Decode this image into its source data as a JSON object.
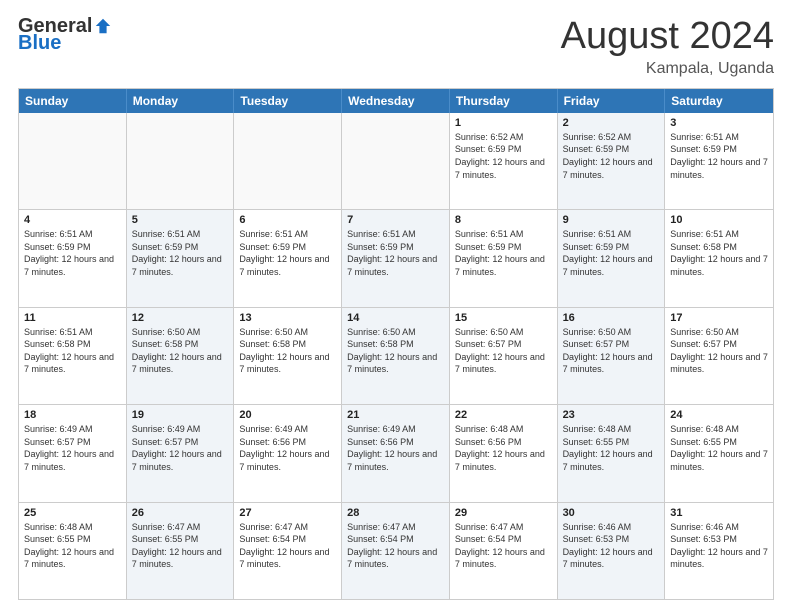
{
  "logo": {
    "general": "General",
    "blue": "Blue"
  },
  "title": "August 2024",
  "location": "Kampala, Uganda",
  "header_days": [
    "Sunday",
    "Monday",
    "Tuesday",
    "Wednesday",
    "Thursday",
    "Friday",
    "Saturday"
  ],
  "rows": [
    [
      {
        "day": "",
        "info": "",
        "empty": true
      },
      {
        "day": "",
        "info": "",
        "empty": true
      },
      {
        "day": "",
        "info": "",
        "empty": true
      },
      {
        "day": "",
        "info": "",
        "empty": true
      },
      {
        "day": "1",
        "info": "Sunrise: 6:52 AM\nSunset: 6:59 PM\nDaylight: 12 hours and 7 minutes.",
        "empty": false,
        "shaded": false
      },
      {
        "day": "2",
        "info": "Sunrise: 6:52 AM\nSunset: 6:59 PM\nDaylight: 12 hours and 7 minutes.",
        "empty": false,
        "shaded": true
      },
      {
        "day": "3",
        "info": "Sunrise: 6:51 AM\nSunset: 6:59 PM\nDaylight: 12 hours and 7 minutes.",
        "empty": false,
        "shaded": false
      }
    ],
    [
      {
        "day": "4",
        "info": "Sunrise: 6:51 AM\nSunset: 6:59 PM\nDaylight: 12 hours and 7 minutes.",
        "empty": false,
        "shaded": false
      },
      {
        "day": "5",
        "info": "Sunrise: 6:51 AM\nSunset: 6:59 PM\nDaylight: 12 hours and 7 minutes.",
        "empty": false,
        "shaded": true
      },
      {
        "day": "6",
        "info": "Sunrise: 6:51 AM\nSunset: 6:59 PM\nDaylight: 12 hours and 7 minutes.",
        "empty": false,
        "shaded": false
      },
      {
        "day": "7",
        "info": "Sunrise: 6:51 AM\nSunset: 6:59 PM\nDaylight: 12 hours and 7 minutes.",
        "empty": false,
        "shaded": true
      },
      {
        "day": "8",
        "info": "Sunrise: 6:51 AM\nSunset: 6:59 PM\nDaylight: 12 hours and 7 minutes.",
        "empty": false,
        "shaded": false
      },
      {
        "day": "9",
        "info": "Sunrise: 6:51 AM\nSunset: 6:59 PM\nDaylight: 12 hours and 7 minutes.",
        "empty": false,
        "shaded": true
      },
      {
        "day": "10",
        "info": "Sunrise: 6:51 AM\nSunset: 6:58 PM\nDaylight: 12 hours and 7 minutes.",
        "empty": false,
        "shaded": false
      }
    ],
    [
      {
        "day": "11",
        "info": "Sunrise: 6:51 AM\nSunset: 6:58 PM\nDaylight: 12 hours and 7 minutes.",
        "empty": false,
        "shaded": false
      },
      {
        "day": "12",
        "info": "Sunrise: 6:50 AM\nSunset: 6:58 PM\nDaylight: 12 hours and 7 minutes.",
        "empty": false,
        "shaded": true
      },
      {
        "day": "13",
        "info": "Sunrise: 6:50 AM\nSunset: 6:58 PM\nDaylight: 12 hours and 7 minutes.",
        "empty": false,
        "shaded": false
      },
      {
        "day": "14",
        "info": "Sunrise: 6:50 AM\nSunset: 6:58 PM\nDaylight: 12 hours and 7 minutes.",
        "empty": false,
        "shaded": true
      },
      {
        "day": "15",
        "info": "Sunrise: 6:50 AM\nSunset: 6:57 PM\nDaylight: 12 hours and 7 minutes.",
        "empty": false,
        "shaded": false
      },
      {
        "day": "16",
        "info": "Sunrise: 6:50 AM\nSunset: 6:57 PM\nDaylight: 12 hours and 7 minutes.",
        "empty": false,
        "shaded": true
      },
      {
        "day": "17",
        "info": "Sunrise: 6:50 AM\nSunset: 6:57 PM\nDaylight: 12 hours and 7 minutes.",
        "empty": false,
        "shaded": false
      }
    ],
    [
      {
        "day": "18",
        "info": "Sunrise: 6:49 AM\nSunset: 6:57 PM\nDaylight: 12 hours and 7 minutes.",
        "empty": false,
        "shaded": false
      },
      {
        "day": "19",
        "info": "Sunrise: 6:49 AM\nSunset: 6:57 PM\nDaylight: 12 hours and 7 minutes.",
        "empty": false,
        "shaded": true
      },
      {
        "day": "20",
        "info": "Sunrise: 6:49 AM\nSunset: 6:56 PM\nDaylight: 12 hours and 7 minutes.",
        "empty": false,
        "shaded": false
      },
      {
        "day": "21",
        "info": "Sunrise: 6:49 AM\nSunset: 6:56 PM\nDaylight: 12 hours and 7 minutes.",
        "empty": false,
        "shaded": true
      },
      {
        "day": "22",
        "info": "Sunrise: 6:48 AM\nSunset: 6:56 PM\nDaylight: 12 hours and 7 minutes.",
        "empty": false,
        "shaded": false
      },
      {
        "day": "23",
        "info": "Sunrise: 6:48 AM\nSunset: 6:55 PM\nDaylight: 12 hours and 7 minutes.",
        "empty": false,
        "shaded": true
      },
      {
        "day": "24",
        "info": "Sunrise: 6:48 AM\nSunset: 6:55 PM\nDaylight: 12 hours and 7 minutes.",
        "empty": false,
        "shaded": false
      }
    ],
    [
      {
        "day": "25",
        "info": "Sunrise: 6:48 AM\nSunset: 6:55 PM\nDaylight: 12 hours and 7 minutes.",
        "empty": false,
        "shaded": false
      },
      {
        "day": "26",
        "info": "Sunrise: 6:47 AM\nSunset: 6:55 PM\nDaylight: 12 hours and 7 minutes.",
        "empty": false,
        "shaded": true
      },
      {
        "day": "27",
        "info": "Sunrise: 6:47 AM\nSunset: 6:54 PM\nDaylight: 12 hours and 7 minutes.",
        "empty": false,
        "shaded": false
      },
      {
        "day": "28",
        "info": "Sunrise: 6:47 AM\nSunset: 6:54 PM\nDaylight: 12 hours and 7 minutes.",
        "empty": false,
        "shaded": true
      },
      {
        "day": "29",
        "info": "Sunrise: 6:47 AM\nSunset: 6:54 PM\nDaylight: 12 hours and 7 minutes.",
        "empty": false,
        "shaded": false
      },
      {
        "day": "30",
        "info": "Sunrise: 6:46 AM\nSunset: 6:53 PM\nDaylight: 12 hours and 7 minutes.",
        "empty": false,
        "shaded": true
      },
      {
        "day": "31",
        "info": "Sunrise: 6:46 AM\nSunset: 6:53 PM\nDaylight: 12 hours and 7 minutes.",
        "empty": false,
        "shaded": false
      }
    ]
  ]
}
